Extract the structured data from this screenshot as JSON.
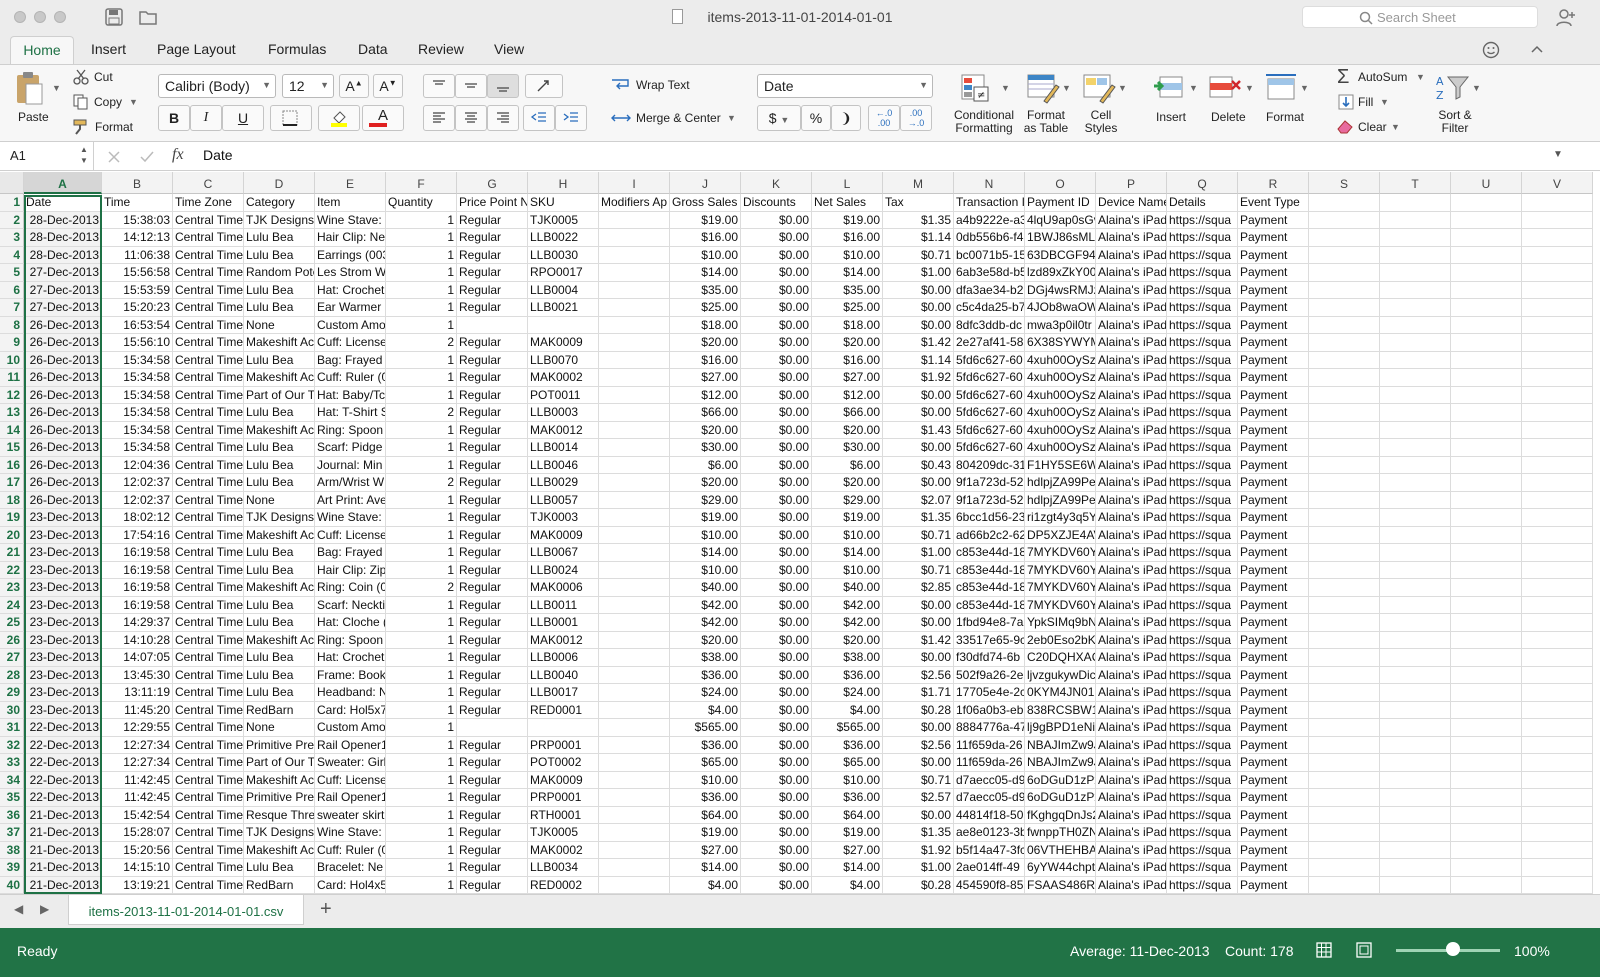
{
  "window": {
    "title": "items-2013-11-01-2014-01-01",
    "search_placeholder": "Search Sheet"
  },
  "tabs": [
    "Home",
    "Insert",
    "Page Layout",
    "Formulas",
    "Data",
    "Review",
    "View"
  ],
  "ribbon": {
    "paste": "Paste",
    "cut": "Cut",
    "copy": "Copy",
    "format": "Format",
    "font_name": "Calibri (Body)",
    "font_size": "12",
    "bold": "B",
    "italic": "I",
    "underline": "U",
    "wrap_text": "Wrap Text",
    "merge_center": "Merge & Center",
    "number_format": "Date",
    "currency": "$",
    "percent": "%",
    "conditional": [
      "Conditional",
      "Formatting"
    ],
    "format_table": [
      "Format",
      "as Table"
    ],
    "cell_styles": [
      "Cell",
      "Styles"
    ],
    "insert": "Insert",
    "delete": "Delete",
    "format_cells": "Format",
    "autosum": "AutoSum",
    "fill": "Fill",
    "clear": "Clear",
    "sort": [
      "Sort &",
      "Filter"
    ]
  },
  "formula": {
    "cell_ref": "A1",
    "fx": "fx",
    "content": "Date"
  },
  "columns": [
    "A",
    "B",
    "C",
    "D",
    "E",
    "F",
    "G",
    "H",
    "I",
    "J",
    "K",
    "L",
    "M",
    "N",
    "O",
    "P",
    "Q",
    "R",
    "S",
    "T",
    "U",
    "V"
  ],
  "header_row": [
    "Date",
    "Time",
    "Time Zone",
    "Category",
    "Item",
    "Quantity",
    "Price Point N",
    "SKU",
    "Modifiers Ap",
    "Gross Sales",
    "Discounts",
    "Net Sales",
    "Tax",
    "Transaction I",
    "Payment ID",
    "Device Name",
    "Details",
    "Event Type"
  ],
  "rows": [
    [
      "28-Dec-2013",
      "15:38:03",
      "Central Time",
      "TJK Designs",
      "Wine Stave: :",
      "1",
      "Regular",
      "TJK0005",
      "",
      "$19.00",
      "$0.00",
      "$19.00",
      "$1.35",
      "a4b9222e-a3",
      "4lqU9ap0sGv",
      "Alaina's iPad",
      "https://squa",
      "Payment"
    ],
    [
      "28-Dec-2013",
      "14:12:13",
      "Central Time",
      "Lulu Bea",
      "Hair Clip: Ne",
      "1",
      "Regular",
      "LLB0022",
      "",
      "$16.00",
      "$0.00",
      "$16.00",
      "$1.14",
      "0db556b6-f4",
      "1BWJ86sMLt",
      "Alaina's iPad",
      "https://squa",
      "Payment"
    ],
    [
      "28-Dec-2013",
      "11:06:38",
      "Central Time",
      "Lulu Bea",
      "Earrings (003",
      "1",
      "Regular",
      "LLB0030",
      "",
      "$10.00",
      "$0.00",
      "$10.00",
      "$0.71",
      "bc0071b5-15",
      "63DBCGF94J",
      "Alaina's iPad",
      "https://squa",
      "Payment"
    ],
    [
      "27-Dec-2013",
      "15:56:58",
      "Central Time",
      "Random Pote",
      "Les Strom W",
      "1",
      "Regular",
      "RPO0017",
      "",
      "$14.00",
      "$0.00",
      "$14.00",
      "$1.00",
      "6ab3e58d-b5",
      "lzd89xZkY00l",
      "Alaina's iPad",
      "https://squa",
      "Payment"
    ],
    [
      "27-Dec-2013",
      "15:53:59",
      "Central Time",
      "Lulu Bea",
      "Hat: Crochet",
      "1",
      "Regular",
      "LLB0004",
      "",
      "$35.00",
      "$0.00",
      "$35.00",
      "$0.00",
      "dfa3ae34-b2",
      "DGj4wsRMJz",
      "Alaina's iPad",
      "https://squa",
      "Payment"
    ],
    [
      "27-Dec-2013",
      "15:20:23",
      "Central Time",
      "Lulu Bea",
      "Ear Warmer",
      "1",
      "Regular",
      "LLB0021",
      "",
      "$25.00",
      "$0.00",
      "$25.00",
      "$0.00",
      "c5c4da25-b7",
      "4JOb8waOW",
      "Alaina's iPad",
      "https://squa",
      "Payment"
    ],
    [
      "26-Dec-2013",
      "16:53:54",
      "Central Time",
      "None",
      "Custom Amo",
      "1",
      "",
      "",
      "",
      "$18.00",
      "$0.00",
      "$18.00",
      "$0.00",
      "8dfc3ddb-dc",
      "mwa3p0il0tr",
      "Alaina's iPad",
      "https://squa",
      "Payment"
    ],
    [
      "26-Dec-2013",
      "15:56:10",
      "Central Time",
      "Makeshift Ac",
      "Cuff: License",
      "2",
      "Regular",
      "MAK0009",
      "",
      "$20.00",
      "$0.00",
      "$20.00",
      "$1.42",
      "2e27af41-58",
      "6X38SYWYM",
      "Alaina's iPad",
      "https://squa",
      "Payment"
    ],
    [
      "26-Dec-2013",
      "15:34:58",
      "Central Time",
      "Lulu Bea",
      "Bag: Frayed I",
      "1",
      "Regular",
      "LLB0070",
      "",
      "$16.00",
      "$0.00",
      "$16.00",
      "$1.14",
      "5fd6c627-60",
      "4xuh00OySz",
      "Alaina's iPad",
      "https://squa",
      "Payment"
    ],
    [
      "26-Dec-2013",
      "15:34:58",
      "Central Time",
      "Makeshift Ac",
      "Cuff: Ruler (0",
      "1",
      "Regular",
      "MAK0002",
      "",
      "$27.00",
      "$0.00",
      "$27.00",
      "$1.92",
      "5fd6c627-60",
      "4xuh00OySz",
      "Alaina's iPad",
      "https://squa",
      "Payment"
    ],
    [
      "26-Dec-2013",
      "15:34:58",
      "Central Time",
      "Part of Our T",
      "Hat: Baby/Tc",
      "1",
      "Regular",
      "POT0011",
      "",
      "$12.00",
      "$0.00",
      "$12.00",
      "$0.00",
      "5fd6c627-60",
      "4xuh00OySz",
      "Alaina's iPad",
      "https://squa",
      "Payment"
    ],
    [
      "26-Dec-2013",
      "15:34:58",
      "Central Time",
      "Lulu Bea",
      "Hat: T-Shirt S",
      "2",
      "Regular",
      "LLB0003",
      "",
      "$66.00",
      "$0.00",
      "$66.00",
      "$0.00",
      "5fd6c627-60",
      "4xuh00OySz",
      "Alaina's iPad",
      "https://squa",
      "Payment"
    ],
    [
      "26-Dec-2013",
      "15:34:58",
      "Central Time",
      "Makeshift Ac",
      "Ring: Spoon (",
      "1",
      "Regular",
      "MAK0012",
      "",
      "$20.00",
      "$0.00",
      "$20.00",
      "$1.43",
      "5fd6c627-60",
      "4xuh00OySz",
      "Alaina's iPad",
      "https://squa",
      "Payment"
    ],
    [
      "26-Dec-2013",
      "15:34:58",
      "Central Time",
      "Lulu Bea",
      "Scarf: Pidge (",
      "1",
      "Regular",
      "LLB0014",
      "",
      "$30.00",
      "$0.00",
      "$30.00",
      "$0.00",
      "5fd6c627-60",
      "4xuh00OySz",
      "Alaina's iPad",
      "https://squa",
      "Payment"
    ],
    [
      "26-Dec-2013",
      "12:04:36",
      "Central Time",
      "Lulu Bea",
      "Journal: Min",
      "1",
      "Regular",
      "LLB0046",
      "",
      "$6.00",
      "$0.00",
      "$6.00",
      "$0.43",
      "804209dc-31",
      "F1HY5SE6W",
      "Alaina's iPad",
      "https://squa",
      "Payment"
    ],
    [
      "26-Dec-2013",
      "12:02:37",
      "Central Time",
      "Lulu Bea",
      "Arm/Wrist W",
      "2",
      "Regular",
      "LLB0029",
      "",
      "$20.00",
      "$0.00",
      "$20.00",
      "$0.00",
      "9f1a723d-52",
      "hdlpjZA99Pe",
      "Alaina's iPad",
      "https://squa",
      "Payment"
    ],
    [
      "26-Dec-2013",
      "12:02:37",
      "Central Time",
      "None",
      "Art Print: Ave",
      "1",
      "Regular",
      "LLB0057",
      "",
      "$29.00",
      "$0.00",
      "$29.00",
      "$2.07",
      "9f1a723d-52",
      "hdlpjZA99Pe",
      "Alaina's iPad",
      "https://squa",
      "Payment"
    ],
    [
      "23-Dec-2013",
      "18:02:12",
      "Central Time",
      "TJK Designs",
      "Wine Stave: (",
      "1",
      "Regular",
      "TJK0003",
      "",
      "$19.00",
      "$0.00",
      "$19.00",
      "$1.35",
      "6bcc1d56-23",
      "ri1zgt4y3q5Y",
      "Alaina's iPad",
      "https://squa",
      "Payment"
    ],
    [
      "23-Dec-2013",
      "17:54:16",
      "Central Time",
      "Makeshift Ac",
      "Cuff: License",
      "1",
      "Regular",
      "MAK0009",
      "",
      "$10.00",
      "$0.00",
      "$10.00",
      "$0.71",
      "ad66b2c2-62",
      "DP5XZJE4AV",
      "Alaina's iPad",
      "https://squa",
      "Payment"
    ],
    [
      "23-Dec-2013",
      "16:19:58",
      "Central Time",
      "Lulu Bea",
      "Bag: Frayed I",
      "1",
      "Regular",
      "LLB0067",
      "",
      "$14.00",
      "$0.00",
      "$14.00",
      "$1.00",
      "c853e44d-18",
      "7MYKDV60Y",
      "Alaina's iPad",
      "https://squa",
      "Payment"
    ],
    [
      "23-Dec-2013",
      "16:19:58",
      "Central Time",
      "Lulu Bea",
      "Hair Clip: Zip",
      "1",
      "Regular",
      "LLB0024",
      "",
      "$10.00",
      "$0.00",
      "$10.00",
      "$0.71",
      "c853e44d-18",
      "7MYKDV60Y",
      "Alaina's iPad",
      "https://squa",
      "Payment"
    ],
    [
      "23-Dec-2013",
      "16:19:58",
      "Central Time",
      "Makeshift Ac",
      "Ring: Coin (0",
      "2",
      "Regular",
      "MAK0006",
      "",
      "$40.00",
      "$0.00",
      "$40.00",
      "$2.85",
      "c853e44d-18",
      "7MYKDV60Y",
      "Alaina's iPad",
      "https://squa",
      "Payment"
    ],
    [
      "23-Dec-2013",
      "16:19:58",
      "Central Time",
      "Lulu Bea",
      "Scarf: Neckti",
      "1",
      "Regular",
      "LLB0011",
      "",
      "$42.00",
      "$0.00",
      "$42.00",
      "$0.00",
      "c853e44d-18",
      "7MYKDV60Y",
      "Alaina's iPad",
      "https://squa",
      "Payment"
    ],
    [
      "23-Dec-2013",
      "14:29:37",
      "Central Time",
      "Lulu Bea",
      "Hat: Cloche (",
      "1",
      "Regular",
      "LLB0001",
      "",
      "$42.00",
      "$0.00",
      "$42.00",
      "$0.00",
      "1fbd94e8-7a",
      "YpkSIMq9bN",
      "Alaina's iPad",
      "https://squa",
      "Payment"
    ],
    [
      "23-Dec-2013",
      "14:10:28",
      "Central Time",
      "Makeshift Ac",
      "Ring: Spoon (",
      "1",
      "Regular",
      "MAK0012",
      "",
      "$20.00",
      "$0.00",
      "$20.00",
      "$1.42",
      "33517e65-9c",
      "2eb0Eso2bK",
      "Alaina's iPad",
      "https://squa",
      "Payment"
    ],
    [
      "23-Dec-2013",
      "14:07:05",
      "Central Time",
      "Lulu Bea",
      "Hat: Crochet",
      "1",
      "Regular",
      "LLB0006",
      "",
      "$38.00",
      "$0.00",
      "$38.00",
      "$0.00",
      "f30dfd74-6b",
      "C20DQHXAQ",
      "Alaina's iPad",
      "https://squa",
      "Payment"
    ],
    [
      "23-Dec-2013",
      "13:45:30",
      "Central Time",
      "Lulu Bea",
      "Frame: Book",
      "1",
      "Regular",
      "LLB0040",
      "",
      "$36.00",
      "$0.00",
      "$36.00",
      "$2.56",
      "502f9a26-2e",
      "ljvzgukywDic",
      "Alaina's iPad",
      "https://squa",
      "Payment"
    ],
    [
      "23-Dec-2013",
      "13:11:19",
      "Central Time",
      "Lulu Bea",
      "Headband: N",
      "1",
      "Regular",
      "LLB0017",
      "",
      "$24.00",
      "$0.00",
      "$24.00",
      "$1.71",
      "17705e4e-2c",
      "0KYM4JN01F",
      "Alaina's iPad",
      "https://squa",
      "Payment"
    ],
    [
      "23-Dec-2013",
      "11:45:20",
      "Central Time",
      "RedBarn",
      "Card: Hol5x7",
      "1",
      "Regular",
      "RED0001",
      "",
      "$4.00",
      "$0.00",
      "$4.00",
      "$0.28",
      "1f06a0b3-eb",
      "838RCSBW1Y",
      "Alaina's iPad",
      "https://squa",
      "Payment"
    ],
    [
      "22-Dec-2013",
      "12:29:55",
      "Central Time",
      "None",
      "Custom Amo",
      "1",
      "",
      "",
      "",
      "$565.00",
      "$0.00",
      "$565.00",
      "$0.00",
      "8884776a-47",
      "lj9gBPD1eNi",
      "Alaina's iPad",
      "https://squa",
      "Payment"
    ],
    [
      "22-Dec-2013",
      "12:27:34",
      "Central Time",
      "Primitive Pre",
      "Rail Opener1",
      "1",
      "Regular",
      "PRP0001",
      "",
      "$36.00",
      "$0.00",
      "$36.00",
      "$2.56",
      "11f659da-26",
      "NBAJImZw9J",
      "Alaina's iPad",
      "https://squa",
      "Payment"
    ],
    [
      "22-Dec-2013",
      "12:27:34",
      "Central Time",
      "Part of Our T",
      "Sweater: Girl",
      "1",
      "Regular",
      "POT0002",
      "",
      "$65.00",
      "$0.00",
      "$65.00",
      "$0.00",
      "11f659da-26",
      "NBAJImZw9J",
      "Alaina's iPad",
      "https://squa",
      "Payment"
    ],
    [
      "22-Dec-2013",
      "11:42:45",
      "Central Time",
      "Makeshift Ac",
      "Cuff: License",
      "1",
      "Regular",
      "MAK0009",
      "",
      "$10.00",
      "$0.00",
      "$10.00",
      "$0.71",
      "d7aecc05-d9",
      "6oDGuD1zPx",
      "Alaina's iPad",
      "https://squa",
      "Payment"
    ],
    [
      "22-Dec-2013",
      "11:42:45",
      "Central Time",
      "Primitive Pre",
      "Rail Opener1",
      "1",
      "Regular",
      "PRP0001",
      "",
      "$36.00",
      "$0.00",
      "$36.00",
      "$2.57",
      "d7aecc05-d9",
      "6oDGuD1zPx",
      "Alaina's iPad",
      "https://squa",
      "Payment"
    ],
    [
      "21-Dec-2013",
      "15:42:54",
      "Central Time",
      "Resque Three",
      "sweater skirt",
      "1",
      "Regular",
      "RTH0001",
      "",
      "$64.00",
      "$0.00",
      "$64.00",
      "$0.00",
      "44814f18-50",
      "fKghgqDnJs2",
      "Alaina's iPad",
      "https://squa",
      "Payment"
    ],
    [
      "21-Dec-2013",
      "15:28:07",
      "Central Time",
      "TJK Designs",
      "Wine Stave: :",
      "1",
      "Regular",
      "TJK0005",
      "",
      "$19.00",
      "$0.00",
      "$19.00",
      "$1.35",
      "ae8e0123-3b",
      "fwnppTH0ZN",
      "Alaina's iPad",
      "https://squa",
      "Payment"
    ],
    [
      "21-Dec-2013",
      "15:20:56",
      "Central Time",
      "Makeshift Ac",
      "Cuff: Ruler (0",
      "1",
      "Regular",
      "MAK0002",
      "",
      "$27.00",
      "$0.00",
      "$27.00",
      "$1.92",
      "b5f14a47-3fc",
      "06VTHEHBAE",
      "Alaina's iPad",
      "https://squa",
      "Payment"
    ],
    [
      "21-Dec-2013",
      "14:15:10",
      "Central Time",
      "Lulu Bea",
      "Bracelet: Ne",
      "1",
      "Regular",
      "LLB0034",
      "",
      "$14.00",
      "$0.00",
      "$14.00",
      "$1.00",
      "2ae014ff-49",
      "6yYW44chpt",
      "Alaina's iPad",
      "https://squa",
      "Payment"
    ],
    [
      "21-Dec-2013",
      "13:19:21",
      "Central Time",
      "RedBarn",
      "Card: Hol4x5",
      "1",
      "Regular",
      "RED0002",
      "",
      "$4.00",
      "$0.00",
      "$4.00",
      "$0.28",
      "454590f8-85",
      "FSAAS486RT",
      "Alaina's iPad",
      "https://squa",
      "Payment"
    ]
  ],
  "sheet_tab": "items-2013-11-01-2014-01-01.csv",
  "add_sheet": "+",
  "status": {
    "ready": "Ready",
    "average": "Average: 11-Dec-2013",
    "count": "Count: 178",
    "zoom": "100%",
    "zoom_level": 0.55
  },
  "colors": {
    "accent": "#217346",
    "selection": "#1e7145"
  }
}
